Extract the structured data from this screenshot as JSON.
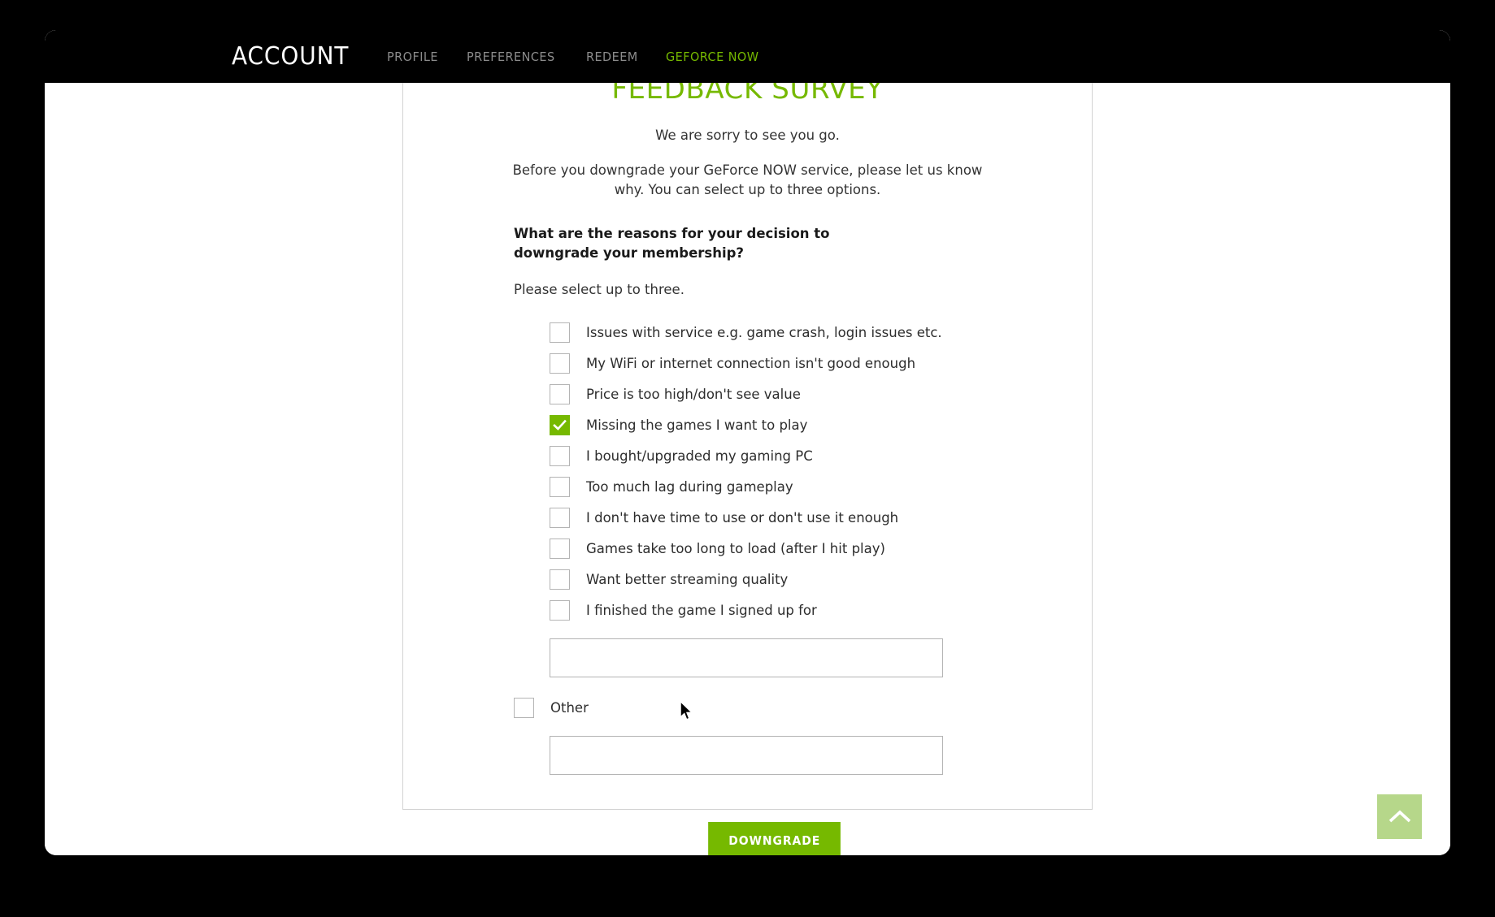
{
  "nav": {
    "title": "ACCOUNT",
    "links": [
      {
        "label": "PROFILE",
        "active": false
      },
      {
        "label": "PREFERENCES",
        "active": false
      },
      {
        "label": "REDEEM",
        "active": false
      },
      {
        "label": "GEFORCE NOW",
        "active": true
      }
    ]
  },
  "survey": {
    "heading": "FEEDBACK SURVEY",
    "sorry_line": "We are sorry to see you go.",
    "intro": "Before you downgrade your GeForce NOW service, please let us know why. You can select up to three options.",
    "question": "What are the reasons for your decision to downgrade your membership?",
    "select_hint": "Please select up to three.",
    "options": [
      {
        "label": "Issues with service e.g. game crash, login issues etc.",
        "checked": false
      },
      {
        "label": "My WiFi or internet connection isn't good enough",
        "checked": false
      },
      {
        "label": "Price is too high/don't see value",
        "checked": false
      },
      {
        "label": "Missing the games I want to play",
        "checked": true
      },
      {
        "label": "I bought/upgraded my gaming PC",
        "checked": false
      },
      {
        "label": "Too much lag during gameplay",
        "checked": false
      },
      {
        "label": "I don't have time to use or don't use it enough",
        "checked": false
      },
      {
        "label": "Games take too long to load (after I hit play)",
        "checked": false
      },
      {
        "label": "Want better streaming quality",
        "checked": false
      },
      {
        "label": "I finished the game I signed up for",
        "checked": false
      }
    ],
    "missing_games_input": {
      "value": "",
      "placeholder": ""
    },
    "other_option": {
      "label": "Other",
      "checked": false
    },
    "other_input": {
      "value": "",
      "placeholder": ""
    },
    "submit_label": "DOWNGRADE"
  },
  "scroll_top": {
    "icon": "chevron-up-icon"
  },
  "colors": {
    "brand_green": "#76b900",
    "scroll_top_green": "#b6d78a",
    "nav_background": "#000000",
    "nav_link": "#8c8c8c",
    "card_border": "#d2d2d2"
  }
}
